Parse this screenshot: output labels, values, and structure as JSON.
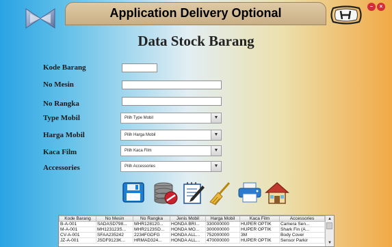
{
  "window": {
    "title": "Application Delivery Optional"
  },
  "page": {
    "heading": "Data Stock Barang"
  },
  "form": {
    "kode_barang": {
      "label": "Kode Barang",
      "value": ""
    },
    "no_mesin": {
      "label": "No Mesin",
      "value": ""
    },
    "no_rangka": {
      "label": "No Rangka",
      "value": ""
    },
    "type_mobil": {
      "label": "Type Mobil",
      "selected": "Pilih Type Mobil"
    },
    "harga_mobil": {
      "label": "Harga Mobil",
      "selected": "Pilih Harga Mobil"
    },
    "kaca_film": {
      "label": "Kaca Film",
      "selected": "Pilih Kaca Film"
    },
    "accessories": {
      "label": "Accessories",
      "selected": "Pilih Accessories"
    }
  },
  "toolbar": {
    "icons": [
      "save-icon",
      "delete-database-icon",
      "edit-icon",
      "clear-broom-icon",
      "print-icon",
      "home-icon"
    ]
  },
  "table": {
    "columns": [
      "Kode Barang",
      "No Mesin",
      "No Rangka",
      "Jenis Mobil",
      "Harga Mobil",
      "Kaca Film",
      "Accessories"
    ],
    "rows": [
      [
        "B-A-001",
        "SADASD798...",
        "MHR128120...",
        "HONDA BRI...",
        "330000000",
        "HUPER OPTIK",
        "Camera Sen..."
      ],
      [
        "M-A-001",
        "MH123123S...",
        "MHR2123SD...",
        "HONDA MO...",
        "300000000",
        "HUPER OPTIK",
        "Shark Fin (A..."
      ],
      [
        "CV-A-001",
        "SFAA235242",
        "2234FGDFG",
        "HONDA ALL...",
        "752000000",
        "3M",
        "Body Cover"
      ],
      [
        "JZ-A-001",
        "JSDF9123K...",
        "HRMAD324...",
        "HONDA ALL...",
        "470000000",
        "HUPER OPTIK",
        "Sensor Parkir"
      ]
    ]
  },
  "colors": {
    "gradient_left": "#2aa3e4",
    "gradient_mid": "#e2eef3",
    "gradient_right": "#f1a947",
    "titlebar": "#d2b990",
    "close_button": "#d62b3a"
  }
}
